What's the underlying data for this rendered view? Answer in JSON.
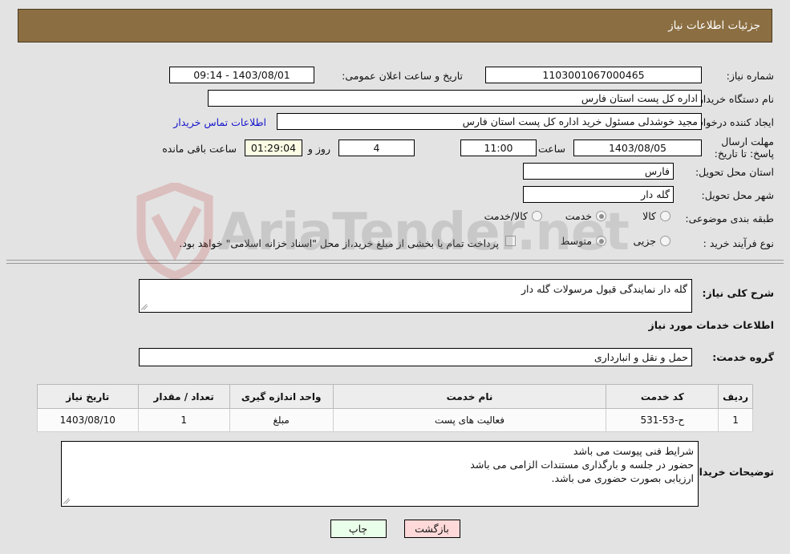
{
  "header": {
    "title": "جزئیات اطلاعات نیاز"
  },
  "form": {
    "need_number_label": "شماره نیاز:",
    "need_number_value": "1103001067000465",
    "announce_datetime_label": "تاریخ و ساعت اعلان عمومی:",
    "announce_datetime_value": "1403/08/01 - 09:14",
    "buyer_org_label": "نام دستگاه خریدار:",
    "buyer_org_value": "اداره کل پست استان فارس",
    "requester_label": "ایجاد کننده درخواست:",
    "requester_value": "مجید خوشدلی مسئول خرید اداره کل پست استان فارس",
    "contact_link": "اطلاعات تماس خریدار",
    "deadline_label": "مهلت ارسال پاسخ: تا تاریخ:",
    "deadline_date": "1403/08/05",
    "hour_label": "ساعت",
    "deadline_time": "11:00",
    "days_value": "4",
    "days_label": "روز و",
    "countdown_value": "01:29:04",
    "remaining_label": "ساعت باقی مانده",
    "province_label": "استان محل تحویل:",
    "province_value": "فارس",
    "city_label": "شهر محل تحویل:",
    "city_value": "گله دار",
    "category_label": "طبقه بندی موضوعی:",
    "category_options": [
      {
        "label": "کالا",
        "selected": false
      },
      {
        "label": "خدمت",
        "selected": true
      },
      {
        "label": "کالا/خدمت",
        "selected": false
      }
    ],
    "process_label": "نوع فرآیند خرید :",
    "process_options": [
      {
        "label": "جزیی",
        "selected": false
      },
      {
        "label": "متوسط",
        "selected": true
      }
    ],
    "treasury_note": "پرداخت تمام یا بخشی از مبلغ خرید،از محل \"اسناد خزانه اسلامی\" خواهد بود."
  },
  "description": {
    "label": "شرح کلی نیاز:",
    "value": "گله دار نمایندگی قبول مرسولات گله دار"
  },
  "services_section": {
    "heading": "اطلاعات خدمات مورد نیاز",
    "group_label": "گروه خدمت:",
    "group_value": "حمل و نقل و انبارداری"
  },
  "table": {
    "columns": [
      "ردیف",
      "کد خدمت",
      "نام خدمت",
      "واحد اندازه گیری",
      "تعداد / مقدار",
      "تاریخ نیاز"
    ],
    "rows": [
      [
        "1",
        "ح-53-531",
        "فعالیت های پست",
        "مبلغ",
        "1",
        "1403/08/10"
      ]
    ]
  },
  "buyer_notes": {
    "label": "توضیحات خریدار:",
    "lines": [
      "شرایط فنی پیوست می باشد",
      "حضور در جلسه و بارگذاری مستندات الزامی می باشد",
      "ارزیابی بصورت حضوری می باشد."
    ]
  },
  "footer": {
    "print_label": "چاپ",
    "back_label": "بازگشت"
  },
  "watermark": {
    "text_left": "AriaTender",
    "text_right": ".net"
  },
  "colors": {
    "header_bg": "#8b6e42",
    "page_bg": "#e3e3e3",
    "link": "#1414cc",
    "countdown_bg": "#fbfbe4",
    "print_bg": "#eaffe9",
    "back_bg": "#ffd9d9"
  }
}
